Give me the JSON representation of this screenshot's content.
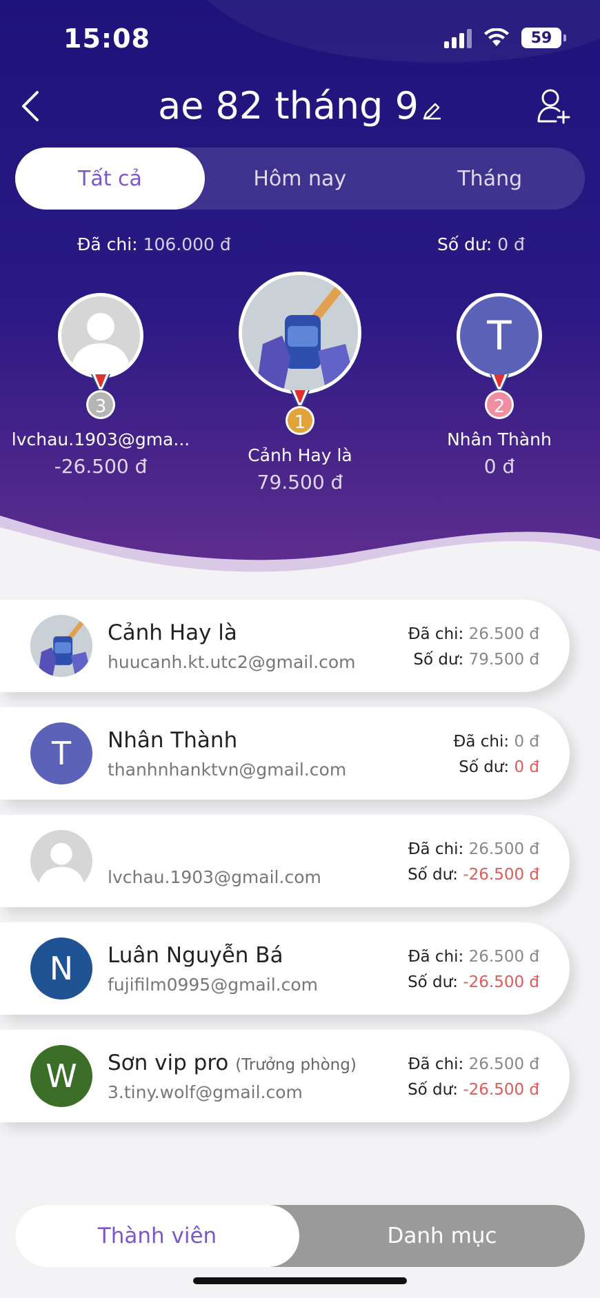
{
  "status_bar": {
    "time": "15:08",
    "battery": "59"
  },
  "header": {
    "title": "ae 82 tháng 9"
  },
  "tabs": [
    {
      "label": "Tất cả",
      "active": true
    },
    {
      "label": "Hôm nay",
      "active": false
    },
    {
      "label": "Tháng",
      "active": false
    }
  ],
  "totals": {
    "spent_label": "Đã chi:",
    "spent_value": "106.000 đ",
    "balance_label": "Số dư:",
    "balance_value": "0 đ"
  },
  "podium": [
    {
      "rank": "1",
      "name": "Cảnh Hay là",
      "value": "79.500 đ",
      "medal_color": "#e2a33a"
    },
    {
      "rank": "2",
      "name": "Nhân Thành",
      "value": "0 đ",
      "avatar_letter": "T",
      "avatar_color": "#5b62b8",
      "medal_color": "#f08da0"
    },
    {
      "rank": "3",
      "name": "lvchau.1903@gma...",
      "value": "-26.500 đ",
      "medal_color": "#b5b5b5"
    }
  ],
  "members": [
    {
      "name": "Cảnh Hay là",
      "role": "",
      "email": "huucanh.kt.utc2@gmail.com",
      "spent_label": "Đã chi:",
      "spent": "26.500 đ",
      "balance_label": "Số dư:",
      "balance": "79.500 đ",
      "balance_status": "positive"
    },
    {
      "name": "Nhân Thành",
      "role": "",
      "email": "thanhnhanktvn@gmail.com",
      "spent_label": "Đã chi:",
      "spent": "0 đ",
      "balance_label": "Số dư:",
      "balance": "0 đ",
      "balance_status": "negative",
      "avatar_letter": "T",
      "avatar_color": "#5b62b8"
    },
    {
      "name": "",
      "role": "",
      "email": "lvchau.1903@gmail.com",
      "spent_label": "Đã chi:",
      "spent": "26.500 đ",
      "balance_label": "Số dư:",
      "balance": "-26.500 đ",
      "balance_status": "negative"
    },
    {
      "name": "Luân Nguyễn Bá",
      "role": "",
      "email": "fujifilm0995@gmail.com",
      "spent_label": "Đã chi:",
      "spent": "26.500 đ",
      "balance_label": "Số dư:",
      "balance": "-26.500 đ",
      "balance_status": "negative",
      "avatar_letter": "N",
      "avatar_color": "#1f5394"
    },
    {
      "name": "Sơn vip pro",
      "role": "(Trưởng phòng)",
      "email": "3.tiny.wolf@gmail.com",
      "spent_label": "Đã chi:",
      "spent": "26.500 đ",
      "balance_label": "Số dư:",
      "balance": "-26.500 đ",
      "balance_status": "negative",
      "avatar_letter": "W",
      "avatar_color": "#3b6e27"
    }
  ],
  "bottom_switch": [
    {
      "label": "Thành viên",
      "active": true
    },
    {
      "label": "Danh mục",
      "active": false
    }
  ],
  "colors": {
    "accent": "#7b57c9",
    "negative": "#e05a5a",
    "hero_top": "#23137a",
    "hero_bottom": "#5e2d8c"
  }
}
